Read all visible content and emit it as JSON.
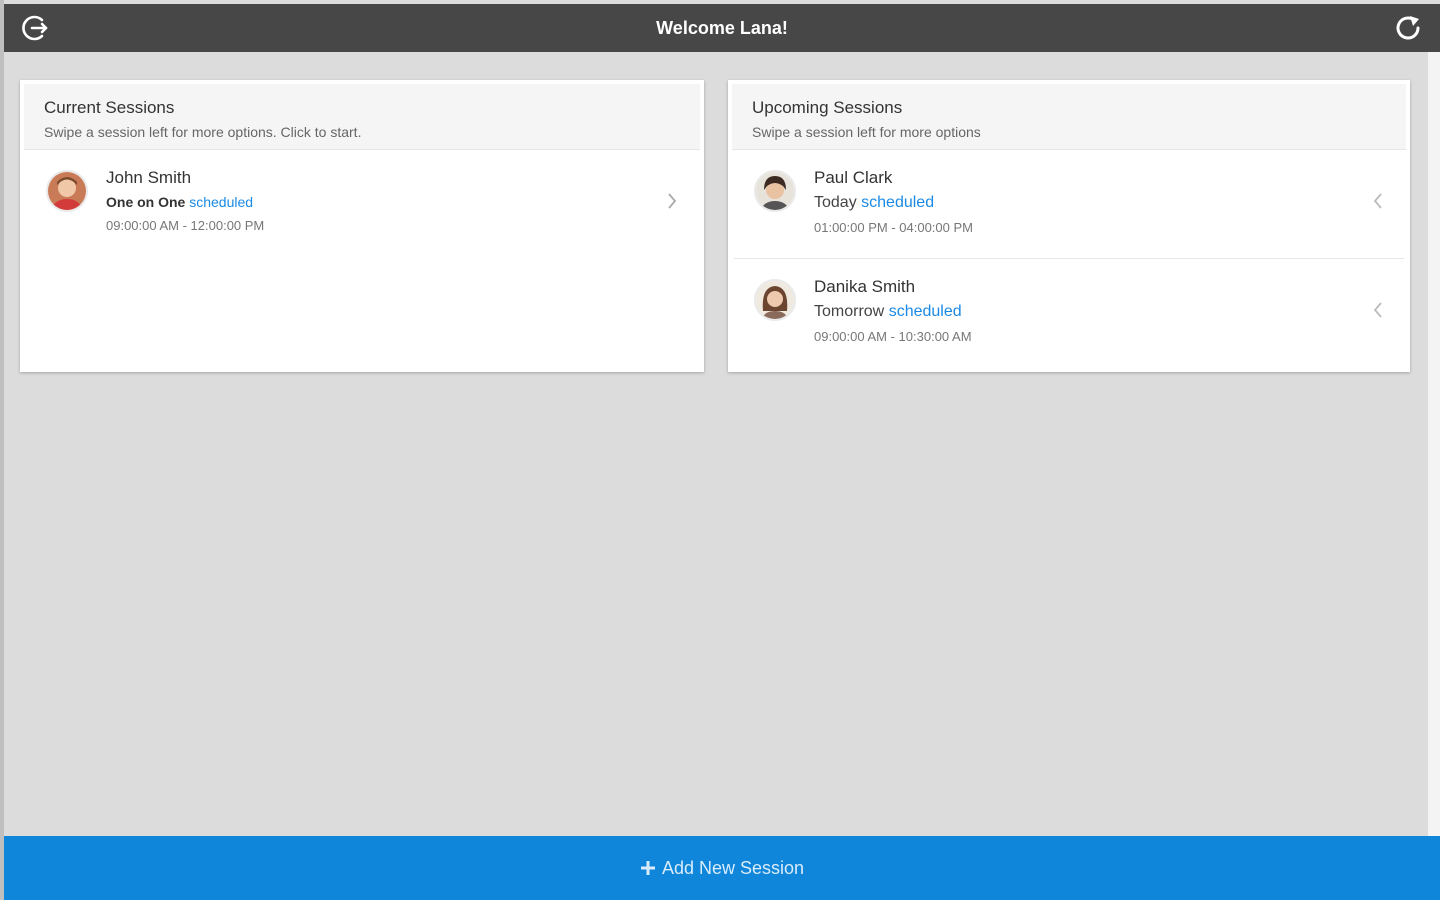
{
  "header": {
    "title": "Welcome Lana!",
    "logout_icon": "logout-icon",
    "refresh_icon": "refresh-icon"
  },
  "current_sessions": {
    "title": "Current Sessions",
    "subtitle": "Swipe a session left for more options. Click to start.",
    "items": [
      {
        "name": "John Smith",
        "type": "One on One",
        "status": "scheduled",
        "time": "09:00:00 AM - 12:00:00 PM"
      }
    ]
  },
  "upcoming_sessions": {
    "title": "Upcoming Sessions",
    "subtitle": "Swipe a session left for more options",
    "items": [
      {
        "name": "Paul Clark",
        "day": "Today",
        "status": "scheduled",
        "time": "01:00:00 PM - 04:00:00 PM"
      },
      {
        "name": "Danika Smith",
        "day": "Tomorrow",
        "status": "scheduled",
        "time": "09:00:00 AM - 10:30:00 AM"
      }
    ]
  },
  "footer": {
    "add_label": "Add New Session",
    "plus_icon": "plus-icon"
  },
  "colors": {
    "header_bg": "#474747",
    "accent": "#1a8ae6",
    "footer_bg": "#0f86d9",
    "page_bg": "#dcdcdc"
  }
}
